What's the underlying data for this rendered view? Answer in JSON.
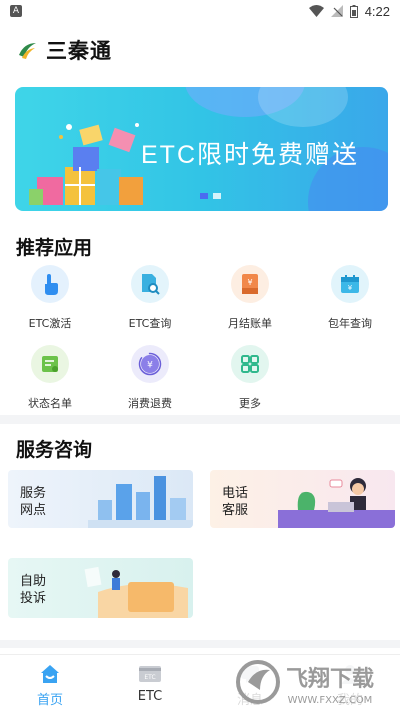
{
  "status_bar": {
    "time": "4:22",
    "left_badge": "A"
  },
  "header": {
    "title": "三秦通"
  },
  "banner": {
    "text": "ETC限时免费赠送"
  },
  "recommended": {
    "title": "推荐应用",
    "apps": [
      {
        "label": "ETC激活",
        "icon": "hand-tap-icon",
        "color": "#3aa3f2"
      },
      {
        "label": "ETC查询",
        "icon": "document-search-icon",
        "color": "#3ab0e0"
      },
      {
        "label": "月结账单",
        "icon": "bill-icon",
        "color": "#f1884a"
      },
      {
        "label": "包年查询",
        "icon": "calendar-icon",
        "color": "#3cb8e8"
      },
      {
        "label": "状态名单",
        "icon": "status-list-icon",
        "color": "#6cc24a"
      },
      {
        "label": "消费退费",
        "icon": "refund-icon",
        "color": "#7b6fe0"
      },
      {
        "label": "更多",
        "icon": "grid-more-icon",
        "color": "#3ac7a0"
      }
    ]
  },
  "services": {
    "title": "服务咨询",
    "cards": [
      {
        "line1": "服务",
        "line2": "网点"
      },
      {
        "line1": "电话",
        "line2": "客服"
      },
      {
        "line1": "自助",
        "line2": "投诉"
      }
    ]
  },
  "tabbar": {
    "tabs": [
      {
        "label": "首页",
        "active": true
      },
      {
        "label": "ETC",
        "active": false
      },
      {
        "label": "消息",
        "active": false
      },
      {
        "label": "我的",
        "active": false
      }
    ]
  },
  "watermark": {
    "brand": "飞翔下载",
    "url": "WWW.FXXZ.COM"
  },
  "colors": {
    "accent": "#3aa3f2",
    "banner": "#36c6e8"
  }
}
